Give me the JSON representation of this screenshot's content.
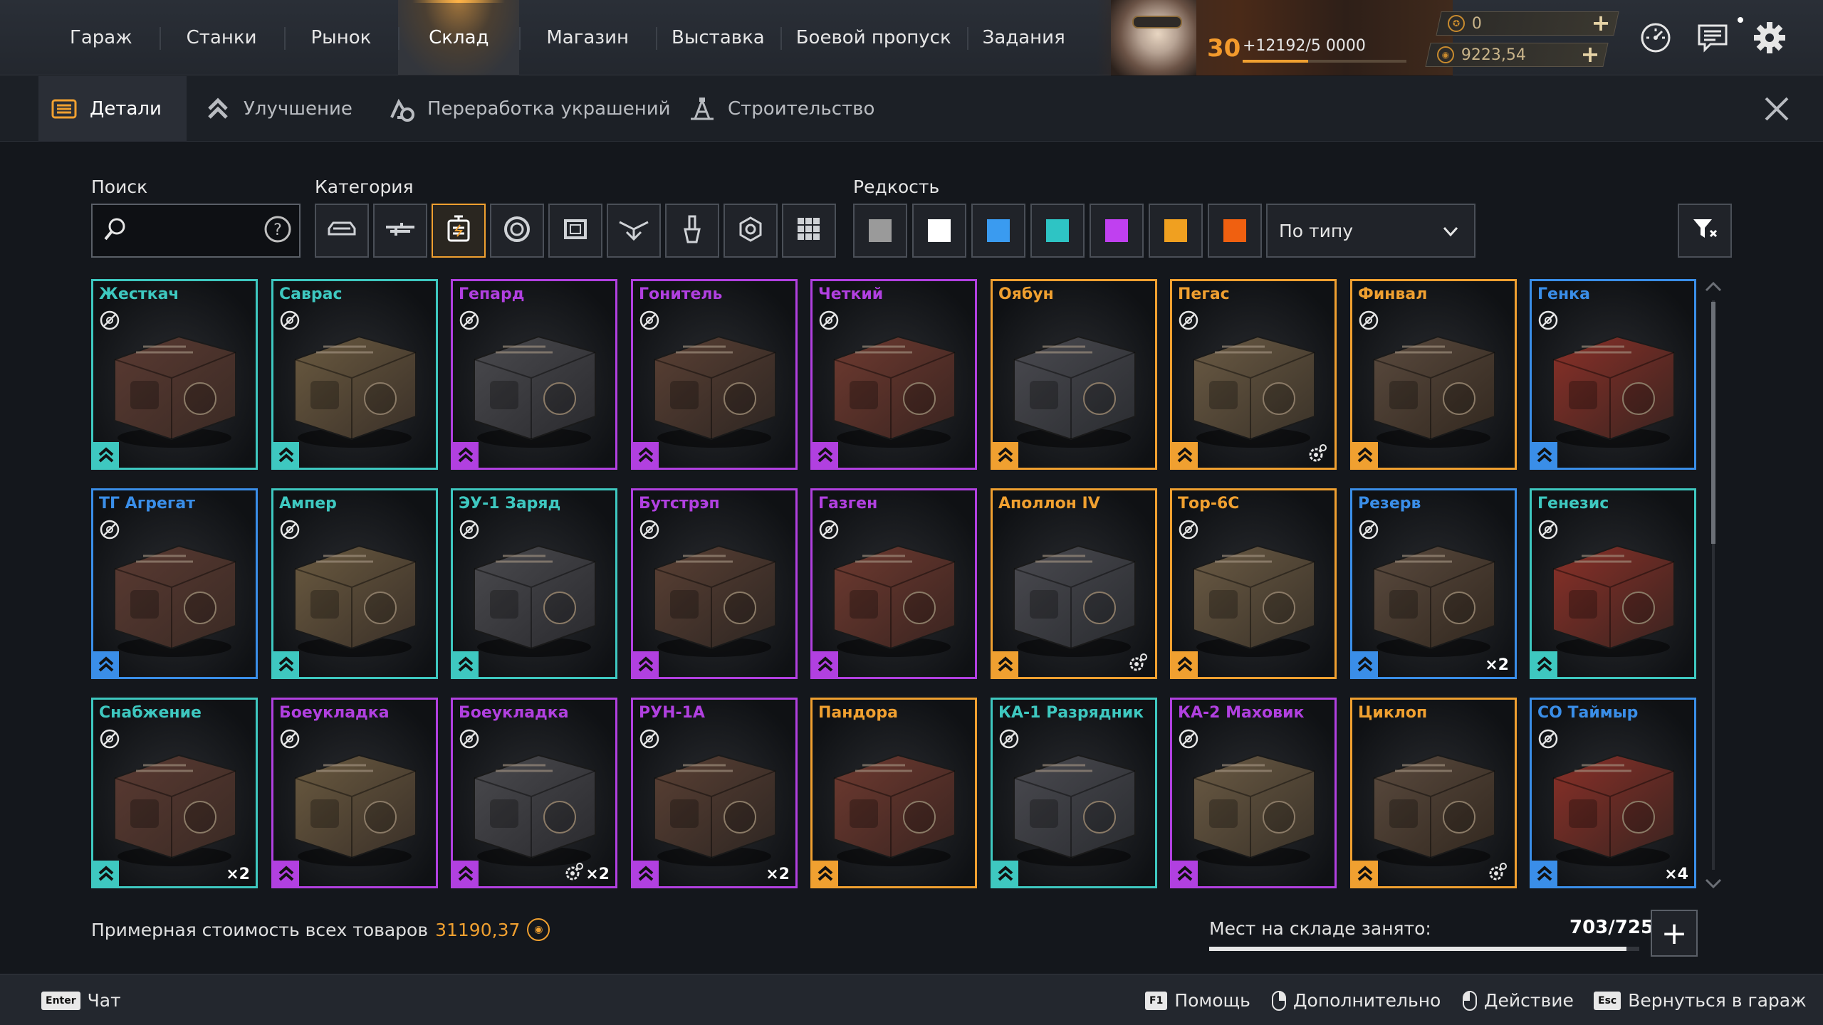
{
  "nav": {
    "items": [
      {
        "label": "Гараж"
      },
      {
        "label": "Станки"
      },
      {
        "label": "Рынок"
      },
      {
        "label": "Склад"
      },
      {
        "label": "Магазин"
      },
      {
        "label": "Выставка"
      },
      {
        "label": "Боевой пропуск"
      },
      {
        "label": "Задания"
      }
    ],
    "active": "Склад"
  },
  "profile": {
    "level": "30",
    "xp_text": "+12192/5 0000",
    "currencies": [
      {
        "amount": "0",
        "icon": "badge-coin-icon"
      },
      {
        "amount": "9223,54",
        "icon": "coin-icon"
      }
    ]
  },
  "top_icons": [
    "speedometer-icon",
    "chat-icon",
    "settings-gear-icon"
  ],
  "subtabs": [
    {
      "label": "Детали",
      "icon": "details-icon",
      "active": true
    },
    {
      "label": "Улучшение",
      "icon": "upgrade-chevrons-icon"
    },
    {
      "label": "Переработка украшений",
      "icon": "recycle-decor-icon"
    },
    {
      "label": "Строительство",
      "icon": "construction-icon"
    }
  ],
  "filters": {
    "search_label": "Поиск",
    "search_value": "",
    "search_placeholder": "",
    "category_label": "Категория",
    "categories": [
      {
        "icon": "cabin-icon"
      },
      {
        "icon": "weapon-icon"
      },
      {
        "icon": "engine-icon",
        "active": true
      },
      {
        "icon": "wheel-icon"
      },
      {
        "icon": "frame-icon"
      },
      {
        "icon": "decor-icon"
      },
      {
        "icon": "paint-icon"
      },
      {
        "icon": "module-icon"
      },
      {
        "icon": "all-grid-icon"
      }
    ],
    "rarity_label": "Редкость",
    "rarities": [
      "#9a9a9a",
      "#ffffff",
      "#3a9bf0",
      "#2ec4c4",
      "#c040f0",
      "#f0a020",
      "#f06010"
    ],
    "sort_value": "По типу"
  },
  "rarity_colors": {
    "teal": "#3ec8c0",
    "purple": "#b140e0",
    "orange": "#f0a030",
    "blue": "#3a8ee8"
  },
  "items": [
    {
      "name": "Жесткач",
      "rarity": "teal",
      "no_icon": true,
      "qty": "",
      "gear": false
    },
    {
      "name": "Саврас",
      "rarity": "teal",
      "no_icon": true,
      "qty": "",
      "gear": false
    },
    {
      "name": "Гепард",
      "rarity": "purple",
      "no_icon": true,
      "qty": "",
      "gear": false
    },
    {
      "name": "Гонитель",
      "rarity": "purple",
      "no_icon": true,
      "qty": "",
      "gear": false
    },
    {
      "name": "Четкий",
      "rarity": "purple",
      "no_icon": true,
      "qty": "",
      "gear": false
    },
    {
      "name": "Оябун",
      "rarity": "orange",
      "no_icon": false,
      "qty": "",
      "gear": false
    },
    {
      "name": "Пегас",
      "rarity": "orange",
      "no_icon": true,
      "qty": "",
      "gear": true
    },
    {
      "name": "Финвал",
      "rarity": "orange",
      "no_icon": true,
      "qty": "",
      "gear": false
    },
    {
      "name": "Генка",
      "rarity": "blue",
      "no_icon": true,
      "qty": "",
      "gear": false
    },
    {
      "name": "ТГ Агрегат",
      "rarity": "blue",
      "no_icon": true,
      "qty": "",
      "gear": false
    },
    {
      "name": "Ампер",
      "rarity": "teal",
      "no_icon": true,
      "qty": "",
      "gear": false
    },
    {
      "name": "ЭУ-1 Заряд",
      "rarity": "teal",
      "no_icon": true,
      "qty": "",
      "gear": false
    },
    {
      "name": "Бутстрэп",
      "rarity": "purple",
      "no_icon": true,
      "qty": "",
      "gear": false
    },
    {
      "name": "Газген",
      "rarity": "purple",
      "no_icon": true,
      "qty": "",
      "gear": false
    },
    {
      "name": "Аполлон IV",
      "rarity": "orange",
      "no_icon": false,
      "qty": "",
      "gear": true
    },
    {
      "name": "Тор-6С",
      "rarity": "orange",
      "no_icon": true,
      "qty": "",
      "gear": false
    },
    {
      "name": "Резерв",
      "rarity": "blue",
      "no_icon": true,
      "qty": "×2",
      "gear": false
    },
    {
      "name": "Генезис",
      "rarity": "teal",
      "no_icon": true,
      "qty": "",
      "gear": false
    },
    {
      "name": "Снабжение",
      "rarity": "teal",
      "no_icon": true,
      "qty": "×2",
      "gear": false
    },
    {
      "name": "Боеукладка",
      "rarity": "purple",
      "no_icon": true,
      "qty": "",
      "gear": false
    },
    {
      "name": "Боеукладка",
      "rarity": "purple",
      "no_icon": true,
      "qty": "×2",
      "gear": true
    },
    {
      "name": "РУН-1А",
      "rarity": "purple",
      "no_icon": true,
      "qty": "×2",
      "gear": false
    },
    {
      "name": "Пандора",
      "rarity": "orange",
      "no_icon": false,
      "qty": "",
      "gear": false
    },
    {
      "name": "КА-1 Разрядник",
      "rarity": "teal",
      "no_icon": true,
      "qty": "",
      "gear": false
    },
    {
      "name": "КА-2 Маховик",
      "rarity": "purple",
      "no_icon": true,
      "qty": "",
      "gear": false
    },
    {
      "name": "Циклоп",
      "rarity": "orange",
      "no_icon": false,
      "qty": "",
      "gear": true
    },
    {
      "name": "СО Таймыр",
      "rarity": "blue",
      "no_icon": true,
      "qty": "×4",
      "gear": false
    }
  ],
  "bottom": {
    "total_label": "Примерная стоимость всех товаров",
    "total_value": "31190,37",
    "storage_label": "Мест на складе занято:",
    "storage_value": "703/725",
    "storage_fraction": 0.97
  },
  "footer": [
    {
      "key": "Enter",
      "label": "Чат"
    },
    {
      "key": "F1",
      "label": "Помощь"
    },
    {
      "key": "mouse-right",
      "label": "Дополнительно"
    },
    {
      "key": "mouse-left",
      "label": "Действие"
    },
    {
      "key": "Esc",
      "label": "Вернуться в гараж"
    }
  ]
}
